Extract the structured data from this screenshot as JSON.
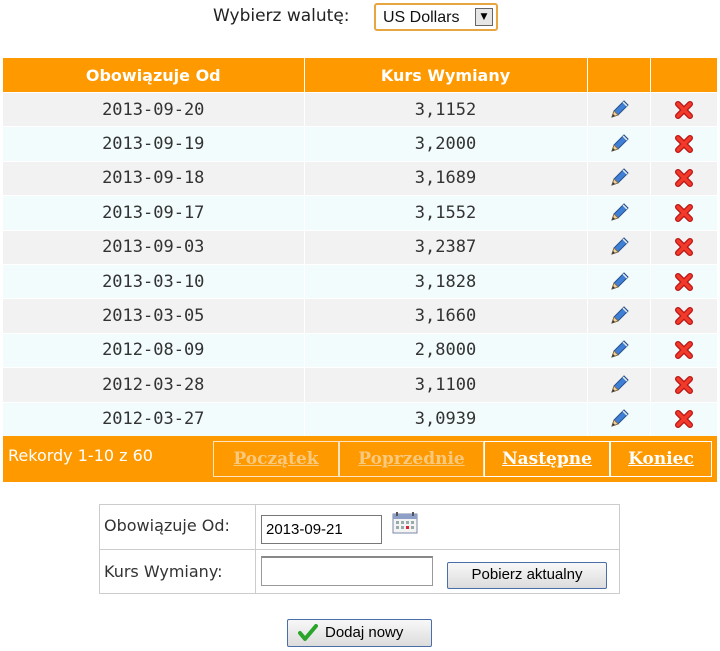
{
  "currency": {
    "label": "Wybierz walutę:",
    "selected": "US Dollars"
  },
  "table": {
    "headers": [
      "Obowiązuje Od",
      "Kurs Wymiany",
      "",
      ""
    ],
    "rows": [
      {
        "date": "2013-09-20",
        "rate": "3,1152"
      },
      {
        "date": "2013-09-19",
        "rate": "3,2000"
      },
      {
        "date": "2013-09-18",
        "rate": "3,1689"
      },
      {
        "date": "2013-09-17",
        "rate": "3,1552"
      },
      {
        "date": "2013-09-03",
        "rate": "3,2387"
      },
      {
        "date": "2013-03-10",
        "rate": "3,1828"
      },
      {
        "date": "2013-03-05",
        "rate": "3,1660"
      },
      {
        "date": "2012-08-09",
        "rate": "2,8000"
      },
      {
        "date": "2012-03-28",
        "rate": "3,1100"
      },
      {
        "date": "2012-03-27",
        "rate": "3,0939"
      }
    ],
    "row_icons": {
      "edit": "pencil-icon",
      "delete": "red-x-icon"
    }
  },
  "pager": {
    "records": "Rekordy 1-10 z 60",
    "first": "Początek",
    "prev": "Poprzednie",
    "next": "Następne",
    "last": "Koniec"
  },
  "form": {
    "date_label": "Obowiązuje Od:",
    "date_value": "2013-09-21",
    "rate_label": "Kurs Wymiany:",
    "rate_value": "",
    "fetch_button": "Pobierz aktualny",
    "calendar_icon": "calendar-icon"
  },
  "add_button": {
    "label": "Dodaj nowy",
    "icon": "green-check-icon"
  },
  "colors": {
    "accent": "#ff9900",
    "row_odd": "#f2f2f2",
    "row_even": "#f2fcfc"
  }
}
